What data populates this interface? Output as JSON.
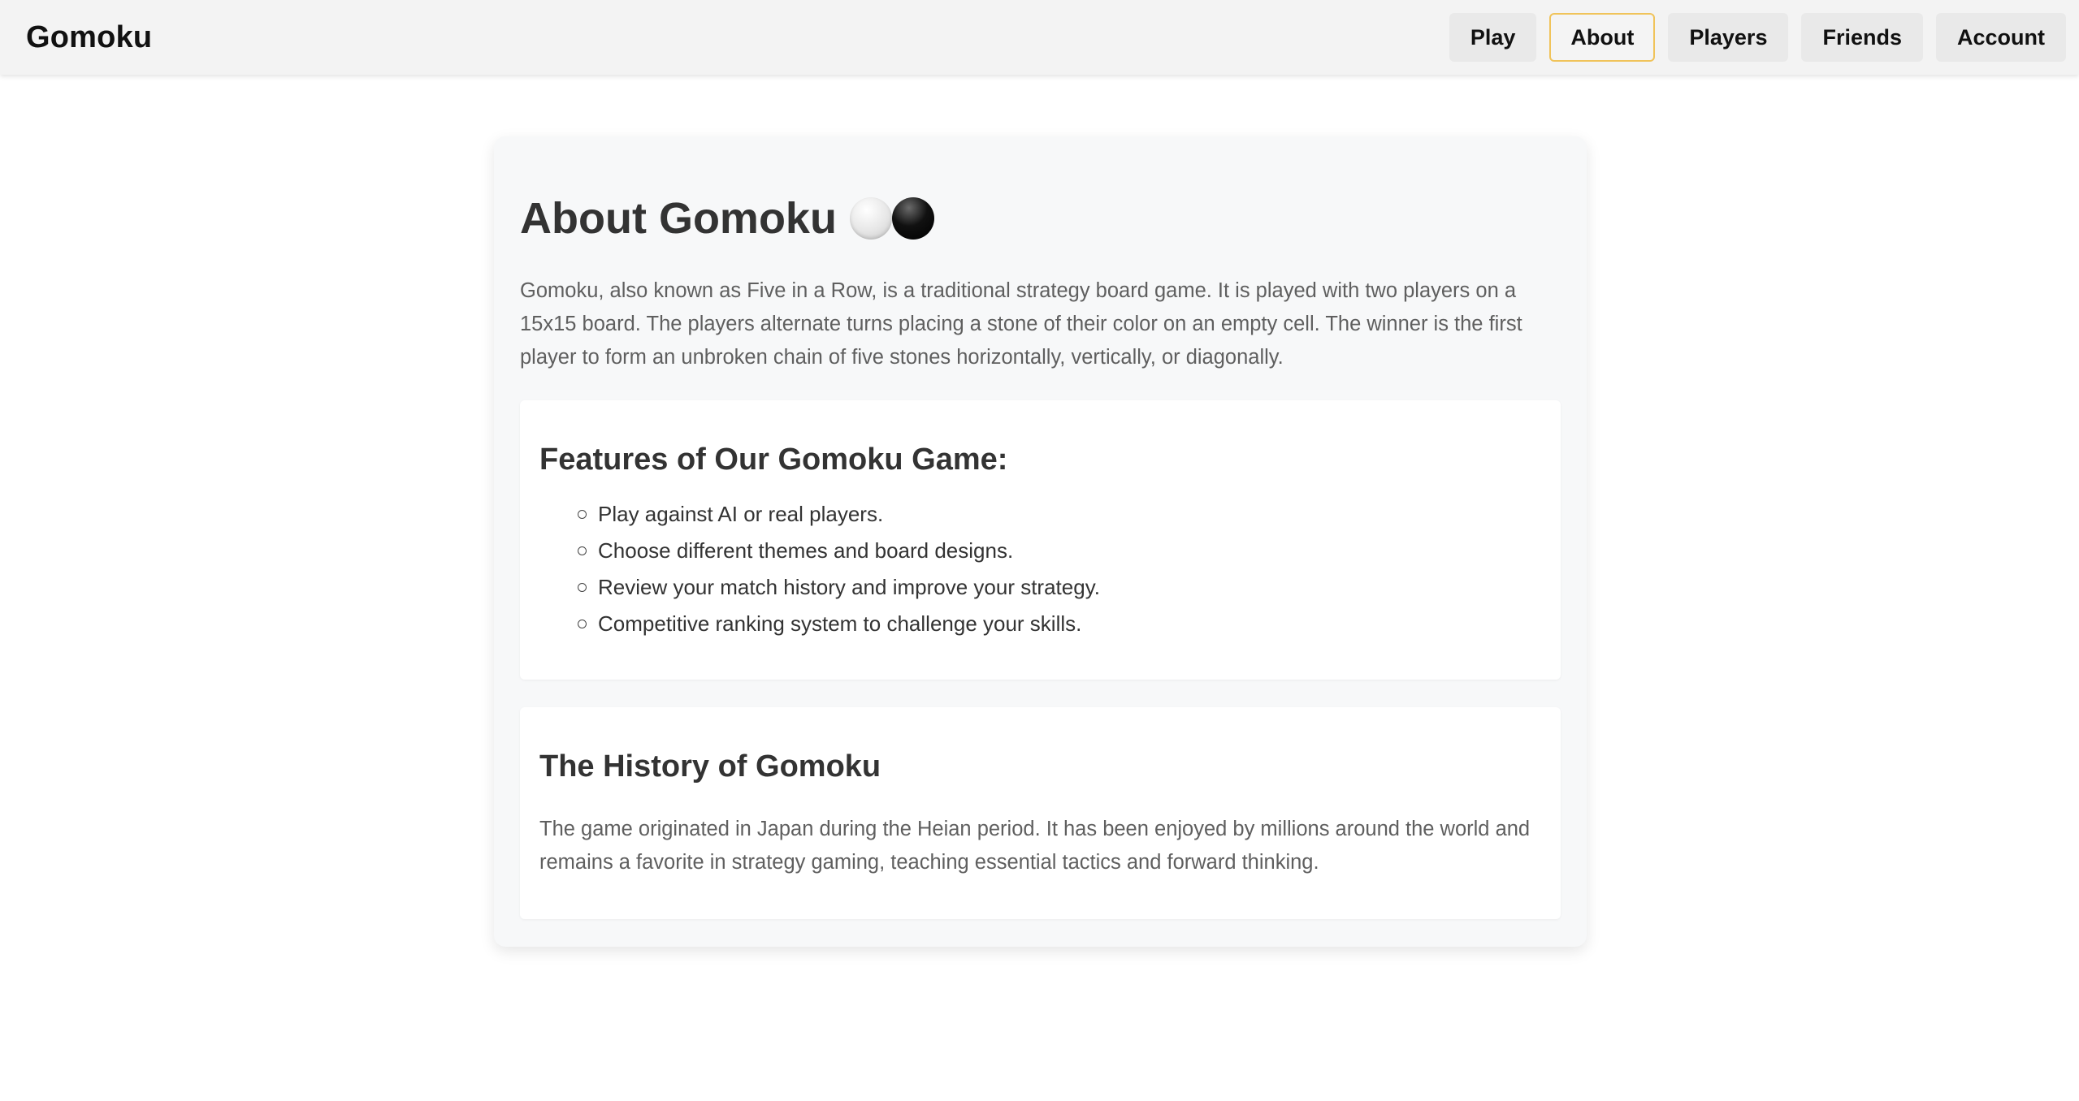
{
  "header": {
    "brand": "Gomoku",
    "nav": [
      {
        "label": "Play",
        "active": false
      },
      {
        "label": "About",
        "active": true
      },
      {
        "label": "Players",
        "active": false
      },
      {
        "label": "Friends",
        "active": false
      },
      {
        "label": "Account",
        "active": false
      }
    ]
  },
  "main": {
    "title": "About Gomoku",
    "title_icons": [
      "white-stone-icon",
      "black-stone-icon"
    ],
    "intro": "Gomoku, also known as Five in a Row, is a traditional strategy board game. It is played with two players on a 15x15 board. The players alternate turns placing a stone of their color on an empty cell. The winner is the first player to form an unbroken chain of five stones horizontally, vertically, or diagonally.",
    "features": {
      "heading": "Features of Our Gomoku Game:",
      "items": [
        "Play against AI or real players.",
        "Choose different themes and board designs.",
        "Review your match history and improve your strategy.",
        "Competitive ranking system to challenge your skills."
      ]
    },
    "history": {
      "heading": "The History of Gomoku",
      "text": "The game originated in Japan during the Heian period. It has been enjoyed by millions around the world and remains a favorite in strategy gaming, teaching essential tactics and forward thinking."
    }
  },
  "colors": {
    "active_border": "#f0c35a",
    "header_bg": "#f3f3f3",
    "card_bg": "#f7f8f9"
  }
}
